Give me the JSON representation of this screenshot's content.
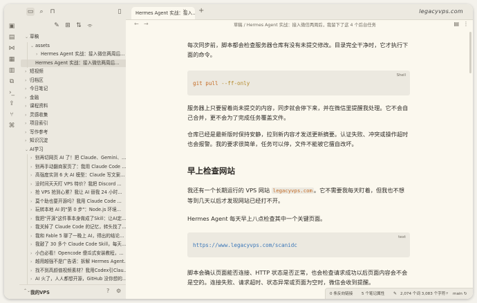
{
  "tab": {
    "title": "Hermes Agent 实战：接入…"
  },
  "watermark": "legacyvps.com",
  "breadcrumb": "草稿 / Hermes Agent 实战：接入微信两周后，我留下了这 4 个后台任务",
  "sidebar": {
    "vault_name": "我的VPS",
    "tree": [
      {
        "label": "草稿",
        "chevron": "⌄",
        "level": 0
      },
      {
        "label": "assets",
        "chevron": "⌄",
        "level": 1
      },
      {
        "label": "Hermes Agent 实战：接入微信两周后...",
        "chevron": "›",
        "level": 2
      },
      {
        "label": "Hermes Agent 实战：接入微信两周后...",
        "chevron": "",
        "level": 1,
        "selected": true
      },
      {
        "label": "短视频",
        "chevron": "›",
        "level": 0
      },
      {
        "label": "归档区",
        "chevron": "›",
        "level": 0
      },
      {
        "label": "今日笔记",
        "chevron": "›",
        "level": 0
      },
      {
        "label": "金融",
        "chevron": "›",
        "level": 0
      },
      {
        "label": "课程资料",
        "chevron": "›",
        "level": 0
      },
      {
        "label": "灵感收集",
        "chevron": "›",
        "level": 0
      },
      {
        "label": "项目索引",
        "chevron": "›",
        "level": 0
      },
      {
        "label": "写作参考",
        "chevron": "›",
        "level": 0
      },
      {
        "label": "知识沉淀",
        "chevron": "›",
        "level": 0
      },
      {
        "label": "AI学习",
        "chevron": "⌄",
        "level": 0
      },
      {
        "label": "别再切网页 AI 了！把 Claude、Gemini、...",
        "chevron": "›",
        "level": 1
      },
      {
        "label": "别再手动翻商家页了：我用 Claude Code ...",
        "chevron": "›",
        "level": 1
      },
      {
        "label": "高强度实测 6 大 AI 模型：Claude 写文案...",
        "chevron": "›",
        "level": 1
      },
      {
        "label": "没时间天天盯 VPS 特价？我把 Discord ...",
        "chevron": "›",
        "level": 1
      },
      {
        "label": "抢 VPS 抢到心累？我让 AI 替我 24 小时...",
        "chevron": "›",
        "level": 1
      },
      {
        "label": "莫个助也要开源吗？我用 Claude Code ...",
        "chevron": "›",
        "level": 1
      },
      {
        "label": "玩转本地 AI 的\"第 0 步\"：Node.js 环境...",
        "chevron": "›",
        "level": 1
      },
      {
        "label": "我把\"开源\"这件事本身做成了Skill：让AI定...",
        "chevron": "›",
        "level": 1
      },
      {
        "label": "我关掉了 Claude Code 的记忆，转头找了...",
        "chevron": "›",
        "level": 1
      },
      {
        "label": "我和 Fable 5 聊了一晚上 AI，得出的结论...",
        "chevron": "›",
        "level": 1
      },
      {
        "label": "我敲了 30 多个 Claude Code Skill，每天...",
        "chevron": "›",
        "level": 1
      },
      {
        "label": "小白必看！Opencode 傻瓜式安装教程，...",
        "chevron": "›",
        "level": 1
      },
      {
        "label": "越用越强不是广告语：拆解 Hermes Agent...",
        "chevron": "›",
        "level": 1
      },
      {
        "label": "找不到高颜值视频素材？我用Codex引Clau...",
        "chevron": "›",
        "level": 1
      },
      {
        "label": "AI 火了，人人都想开源，GitHub 没你想的...",
        "chevron": "›",
        "level": 1
      }
    ]
  },
  "article": {
    "p1": "每次同步前，脚本都会检查服务器仓库有没有未提交修改。目录完全干净时，它才执行下面的命令。",
    "code1_lang": "Shell",
    "code1_cmd": "git pull",
    "code1_flag": "--ff-only",
    "p2": "服务器上只要留着尚未提交的内容，同步就会停下来，并在微信里提醒我处理。它不会自己合并，更不会为了完成任务覆盖文件。",
    "p3": "仓库已经是最新版时保持安静，拉到新内容才发送更新摘要。认证失败、冲突或操作超时也会报警。我的要求很简单，任务可以停，文件不能被它擅自改坏。",
    "h2": "早上检查网站",
    "p4_a": "我还有一个长期运行的 VPS 网站 ",
    "p4_code": "legacyvps.com",
    "p4_b": "。它不需要我每天盯着，但我也不想等到几天以后才发现网站已经打不开。",
    "p5": "Hermes Agent 每天早上八点检查其中一个关键页面。",
    "code2_lang": "text",
    "code2": "https://www.legacyvps.com/scanidc",
    "p6": "脚本会确认页面能否连接、HTTP 状态是否正常，也会检查请求成功以后页面内容会不会是空的。连接失败、请求超时、状态异常或页面为空时，微信会收到提醒。"
  },
  "status": {
    "backlinks": "0 条反向链接",
    "props": "5 个笔记属性",
    "stats": "2,074 个词 3,083 个字符",
    "branch": "main"
  },
  "colors": {
    "accent": "#c46b24",
    "link": "#3a76b8",
    "code_bg": "#ece9e0",
    "content_bg": "#fbf8ee",
    "sidebar_bg": "#ece9e0"
  }
}
